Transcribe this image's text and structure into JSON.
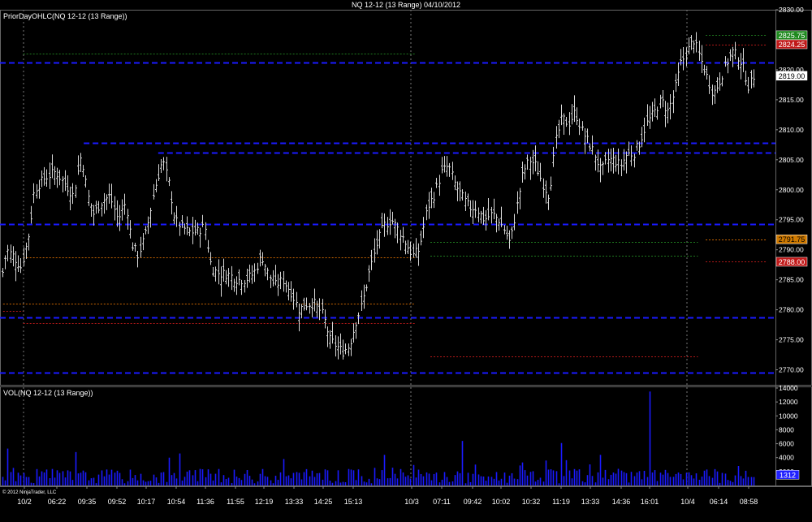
{
  "window": {
    "title": "NQ 12-12 (13 Range)  04/10/2012"
  },
  "colors": {
    "background": "#000000",
    "bar": "#d8d8d8",
    "blue_level": "#1a1aff",
    "volume": "#1a1aff",
    "green_line": "#1f7a1f",
    "red_line": "#b01818",
    "orange_line": "#c86400",
    "grid_vertical": "#777777",
    "axis_text": "#ffffff"
  },
  "copyright": "© 2012 NinjaTrader, LLC",
  "chart_data": [
    {
      "type": "ohlc-range-bars",
      "panel": "price",
      "indicator_label": "PriorDayOHLC(NQ 12-12 (13 Range))",
      "ylim": [
        2767.5,
        2830
      ],
      "y_ticks": [
        "2830.00",
        "2825.00",
        "2820.00",
        "2815.00",
        "2810.00",
        "2805.00",
        "2800.00",
        "2795.00",
        "2790.00",
        "2785.00",
        "2780.00",
        "2775.00",
        "2770.00"
      ],
      "x_tick_labels": [
        "10/2",
        "06:22",
        "09:35",
        "09:52",
        "10:17",
        "10:54",
        "11:36",
        "11:55",
        "12:19",
        "13:33",
        "14:25",
        "15:13",
        "10/3",
        "07:11",
        "09:42",
        "10:02",
        "10:32",
        "11:19",
        "13:33",
        "14:36",
        "16:01",
        "10/4",
        "06:14",
        "08:58"
      ],
      "session_separators": [
        "10/2",
        "10/3",
        "10/4"
      ],
      "close_path": [
        [
          0,
          2784
        ],
        [
          8,
          2790
        ],
        [
          16,
          2789
        ],
        [
          26,
          2787
        ],
        [
          36,
          2793
        ],
        [
          42,
          2800
        ],
        [
          55,
          2802
        ],
        [
          68,
          2803
        ],
        [
          80,
          2801
        ],
        [
          90,
          2799
        ],
        [
          100,
          2806
        ],
        [
          108,
          2799
        ],
        [
          115,
          2796
        ],
        [
          125,
          2798
        ],
        [
          135,
          2799
        ],
        [
          145,
          2795
        ],
        [
          155,
          2798
        ],
        [
          162,
          2791
        ],
        [
          170,
          2789
        ],
        [
          180,
          2793
        ],
        [
          190,
          2800
        ],
        [
          200,
          2805
        ],
        [
          208,
          2801
        ],
        [
          215,
          2795
        ],
        [
          222,
          2794
        ],
        [
          232,
          2793
        ],
        [
          242,
          2793
        ],
        [
          252,
          2794
        ],
        [
          260,
          2787
        ],
        [
          270,
          2786
        ],
        [
          280,
          2786
        ],
        [
          292,
          2785
        ],
        [
          302,
          2785
        ],
        [
          312,
          2786
        ],
        [
          322,
          2789
        ],
        [
          330,
          2786
        ],
        [
          338,
          2784
        ],
        [
          348,
          2785
        ],
        [
          358,
          2783
        ],
        [
          368,
          2780
        ],
        [
          378,
          2781
        ],
        [
          388,
          2781
        ],
        [
          398,
          2779
        ],
        [
          406,
          2775
        ],
        [
          414,
          2774
        ],
        [
          422,
          2773
        ],
        [
          430,
          2774
        ],
        [
          438,
          2778
        ],
        [
          446,
          2781
        ],
        [
          454,
          2786
        ],
        [
          464,
          2791
        ],
        [
          472,
          2794
        ],
        [
          482,
          2795
        ],
        [
          492,
          2793
        ],
        [
          500,
          2791
        ],
        [
          508,
          2789
        ],
        [
          516,
          2790
        ],
        [
          526,
          2797
        ],
        [
          534,
          2799
        ],
        [
          544,
          2803
        ],
        [
          552,
          2804
        ],
        [
          560,
          2801
        ],
        [
          568,
          2799
        ],
        [
          578,
          2797
        ],
        [
          586,
          2797
        ],
        [
          596,
          2795
        ],
        [
          606,
          2796
        ],
        [
          614,
          2795
        ],
        [
          622,
          2793
        ],
        [
          628,
          2791
        ],
        [
          636,
          2797
        ],
        [
          644,
          2803
        ],
        [
          652,
          2805
        ],
        [
          660,
          2804
        ],
        [
          668,
          2801
        ],
        [
          676,
          2799
        ],
        [
          684,
          2808
        ],
        [
          692,
          2812
        ],
        [
          700,
          2811
        ],
        [
          708,
          2813
        ],
        [
          716,
          2810
        ],
        [
          724,
          2808
        ],
        [
          732,
          2806
        ],
        [
          740,
          2803
        ],
        [
          748,
          2805
        ],
        [
          756,
          2805
        ],
        [
          764,
          2804
        ],
        [
          772,
          2806
        ],
        [
          780,
          2806
        ],
        [
          788,
          2808
        ],
        [
          796,
          2811
        ],
        [
          806,
          2813
        ],
        [
          814,
          2815
        ],
        [
          822,
          2813
        ],
        [
          830,
          2816
        ],
        [
          838,
          2821
        ],
        [
          846,
          2823
        ],
        [
          854,
          2825
        ],
        [
          862,
          2822
        ],
        [
          870,
          2819
        ],
        [
          878,
          2816
        ],
        [
          886,
          2818
        ],
        [
          894,
          2821
        ],
        [
          902,
          2823
        ],
        [
          910,
          2822
        ],
        [
          916,
          2820
        ],
        [
          922,
          2817
        ],
        [
          928,
          2819
        ]
      ],
      "price_levels": [
        {
          "role": "prior-day",
          "color": "blue",
          "dashed": true,
          "y": 2821.25,
          "x_from_pct": 0,
          "x_to_pct": 100
        },
        {
          "role": "prior-day",
          "color": "blue",
          "dashed": true,
          "y": 2807.75,
          "x_from_pct": 10.8,
          "x_to_pct": 100
        },
        {
          "role": "prior-day",
          "color": "blue",
          "dashed": true,
          "y": 2806.25,
          "x_from_pct": 20.4,
          "x_to_pct": 100
        },
        {
          "role": "prior-day",
          "color": "blue",
          "dashed": true,
          "y": 2794.25,
          "x_from_pct": 0,
          "x_to_pct": 100
        },
        {
          "role": "prior-day",
          "color": "blue",
          "dashed": true,
          "y": 2778.75,
          "x_from_pct": 0,
          "x_to_pct": 100
        },
        {
          "role": "prior-day",
          "color": "blue",
          "dashed": true,
          "y": 2769.5,
          "x_from_pct": 0,
          "x_to_pct": 100
        },
        {
          "role": "day-high",
          "color": "green",
          "y": 2822.75,
          "x_from_pct": 3.0,
          "x_to_pct": 53.5
        },
        {
          "role": "day-open",
          "color": "orange",
          "y": 2788.75,
          "x_from_pct": 3.0,
          "x_to_pct": 53.5
        },
        {
          "role": "day-close",
          "color": "orange",
          "y": 2781.0,
          "x_from_pct": 0.4,
          "x_to_pct": 53.5
        },
        {
          "role": "day-low",
          "color": "red",
          "y": 2779.75,
          "x_from_pct": 0.4,
          "x_to_pct": 3.0
        },
        {
          "role": "day-low",
          "color": "red",
          "y": 2777.75,
          "x_from_pct": 3.0,
          "x_to_pct": 53.5
        },
        {
          "role": "day-high",
          "color": "green",
          "y": 2791.25,
          "x_from_pct": 55.5,
          "x_to_pct": 90.0
        },
        {
          "role": "day-open",
          "color": "green",
          "y": 2789.0,
          "x_from_pct": 55.5,
          "x_to_pct": 90.0
        },
        {
          "role": "day-low",
          "color": "red",
          "y": 2772.25,
          "x_from_pct": 55.5,
          "x_to_pct": 90.0
        },
        {
          "role": "current-high",
          "color": "green",
          "y": 2825.75,
          "x_from_pct": 91.0,
          "x_to_pct": 98.8
        },
        {
          "role": "current-low",
          "color": "red",
          "y": 2824.25,
          "x_from_pct": 91.0,
          "x_to_pct": 98.8
        },
        {
          "role": "current-open",
          "color": "orange",
          "y": 2791.75,
          "x_from_pct": 91.0,
          "x_to_pct": 98.8
        },
        {
          "role": "current-low",
          "color": "red",
          "y": 2788.0,
          "x_from_pct": 91.0,
          "x_to_pct": 98.8
        }
      ],
      "price_markers": [
        {
          "label": "2825.75",
          "value": 2825.75,
          "bg": "#1f8a1f",
          "fg": "#ffffff"
        },
        {
          "label": "2824.25",
          "value": 2824.25,
          "bg": "#c01818",
          "fg": "#ffffff"
        },
        {
          "label": "2819.00",
          "value": 2819.0,
          "bg": "#ffffff",
          "fg": "#000000"
        },
        {
          "label": "2791.75",
          "value": 2791.75,
          "bg": "#d07a00",
          "fg": "#000000"
        },
        {
          "label": "2788.00",
          "value": 2788.0,
          "bg": "#c01818",
          "fg": "#ffffff"
        }
      ]
    },
    {
      "type": "bar",
      "panel": "volume",
      "indicator_label": "VOL(NQ 12-12 (13 Range))",
      "ylim": [
        0,
        14000
      ],
      "y_ticks": [
        "14000",
        "12000",
        "10000",
        "8000",
        "6000",
        "4000",
        "2000"
      ],
      "last_value_label": "1312",
      "last_value": 1312,
      "peaks": [
        {
          "x": 10,
          "value": 5300
        },
        {
          "x": 92,
          "value": 4800
        },
        {
          "x": 208,
          "value": 4000
        },
        {
          "x": 222,
          "value": 4600
        },
        {
          "x": 350,
          "value": 3800
        },
        {
          "x": 474,
          "value": 4400
        },
        {
          "x": 570,
          "value": 6400
        },
        {
          "x": 692,
          "value": 6100
        },
        {
          "x": 740,
          "value": 4400
        },
        {
          "x": 800,
          "value": 13500
        },
        {
          "x": 908,
          "value": 2800
        }
      ]
    }
  ]
}
